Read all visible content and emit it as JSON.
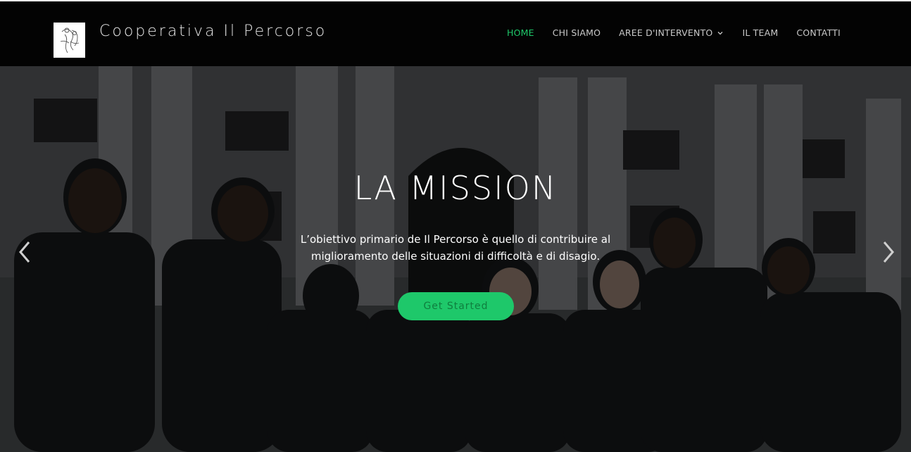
{
  "header": {
    "brand_name": "Cooperativa Il Percorso",
    "logo_icon": "cooperative-logo-icon"
  },
  "nav": {
    "items": [
      {
        "label": "HOME",
        "active": true
      },
      {
        "label": "CHI SIAMO",
        "active": false
      },
      {
        "label": "AREE D'INTERVENTO",
        "active": false,
        "dropdown": true
      },
      {
        "label": "IL TEAM",
        "active": false
      },
      {
        "label": "CONTATTI",
        "active": false
      }
    ]
  },
  "slide": {
    "title": "LA MISSION",
    "text": "L’obiettivo primario de Il Percorso è quello di contribuire al miglioramento delle situazioni di difficoltà e di disagio.",
    "cta_label": "Get Started",
    "prev_icon": "chevron-left-icon",
    "next_icon": "chevron-right-icon"
  },
  "colors": {
    "accent": "#1ec86a",
    "header_bg": "#000000",
    "text": "#ffffff"
  }
}
